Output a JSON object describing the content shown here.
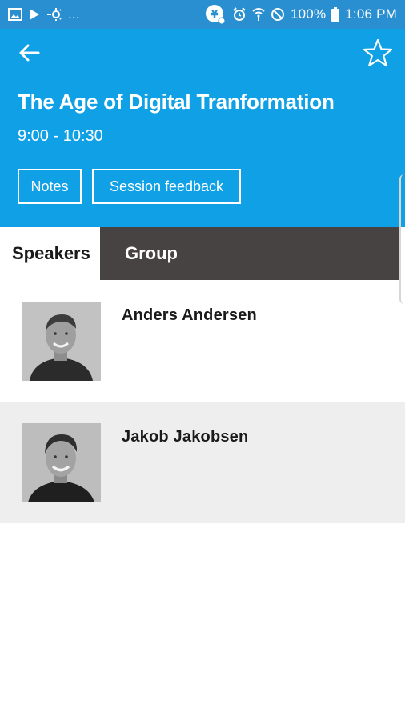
{
  "status_bar": {
    "left_icons": [
      "image-icon",
      "play-store-icon",
      "settings-sun-icon"
    ],
    "overflow_text": "...",
    "battery_text": "100%",
    "time": "1:06 PM"
  },
  "header": {
    "title": "The Age of Digital Tranformation",
    "time": "9:00 - 10:30",
    "buttons": {
      "notes": "Notes",
      "session_feedback": "Session feedback"
    }
  },
  "tabs": [
    {
      "label": "Speakers",
      "active": true
    },
    {
      "label": "Group",
      "active": false
    }
  ],
  "speakers": [
    {
      "name": "Anders Andersen"
    },
    {
      "name": "Jakob Jakobsen"
    }
  ],
  "colors": {
    "status_bar": "#2a8fd0",
    "header": "#0fa0e6",
    "tab_inactive": "#484343",
    "row_alt": "#eeeeee"
  }
}
